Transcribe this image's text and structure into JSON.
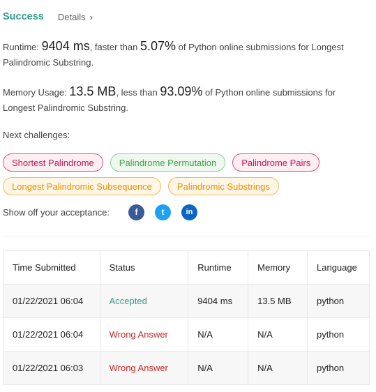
{
  "header": {
    "result": "Success",
    "details_label": "Details",
    "details_chevron": "›"
  },
  "runtime": {
    "label": "Runtime:",
    "value": "9404 ms",
    "comparison_text": ", faster than",
    "percent": "5.07%",
    "suffix": "of Python online submissions for Longest Palindromic Substring."
  },
  "memory": {
    "label": "Memory Usage:",
    "value": "13.5 MB",
    "comparison_text": ", less than",
    "percent": "93.09%",
    "suffix": "of Python online submissions for Longest Palindromic Substring."
  },
  "next_challenges": {
    "label": "Next challenges:",
    "row1": [
      {
        "title": "Shortest Palindrome",
        "difficulty": "hard"
      },
      {
        "title": "Palindrome Permutation",
        "difficulty": "easy"
      },
      {
        "title": "Palindrome Pairs",
        "difficulty": "hard"
      }
    ],
    "row2": [
      {
        "title": "Longest Palindromic Subsequence",
        "difficulty": "medium"
      },
      {
        "title": "Palindromic Substrings",
        "difficulty": "medium"
      }
    ]
  },
  "share": {
    "label": "Show off your acceptance:",
    "icons": [
      "facebook-icon",
      "twitter-icon",
      "linkedin-icon"
    ],
    "glyphs": {
      "facebook": "f",
      "twitter": "t",
      "linkedin": "in"
    }
  },
  "colors": {
    "success": "#2e9e8c",
    "wrong": "#c62828",
    "hard": "#c2185b",
    "easy": "#43a047",
    "medium": "#ef8f00"
  },
  "submissions": {
    "headers": [
      "Time Submitted",
      "Status",
      "Runtime",
      "Memory",
      "Language"
    ],
    "rows": [
      {
        "time": "01/22/2021 06:04",
        "status": "Accepted",
        "runtime": "9404 ms",
        "memory": "13.5 MB",
        "language": "python"
      },
      {
        "time": "01/22/2021 06:04",
        "status": "Wrong Answer",
        "runtime": "N/A",
        "memory": "N/A",
        "language": "python"
      },
      {
        "time": "01/22/2021 06:03",
        "status": "Wrong Answer",
        "runtime": "N/A",
        "memory": "N/A",
        "language": "python"
      }
    ]
  }
}
